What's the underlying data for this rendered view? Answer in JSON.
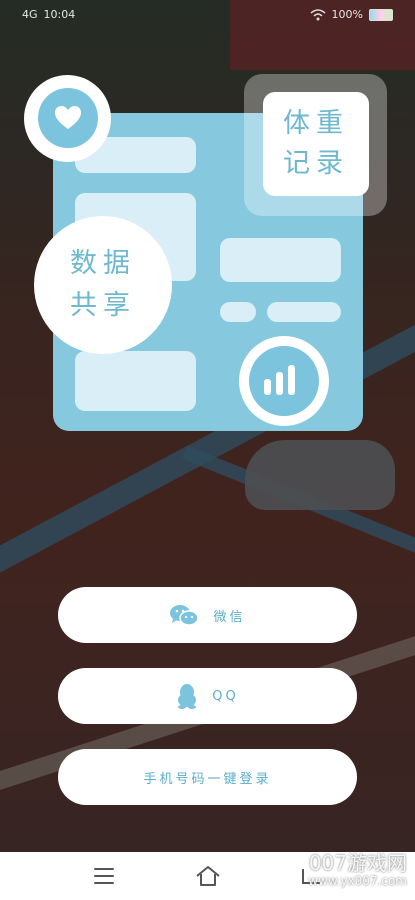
{
  "status_bar": {
    "signal": "4G",
    "time": "10:04",
    "battery": "100%"
  },
  "hero": {
    "weight_title_line1": "体重",
    "weight_title_line2": "记录",
    "share_title_line1": "数据",
    "share_title_line2": "共享",
    "accent_color": "#86c9de"
  },
  "login": {
    "wechat_label": "微信",
    "qq_label": "QQ",
    "phone_label": "手机号码一键登录"
  },
  "watermark": {
    "line1": "007游戏网",
    "line2": "www.yx007.com"
  },
  "icons": [
    "heart-icon",
    "bar-chart-icon",
    "wechat-icon",
    "qq-penguin-icon",
    "menu-icon",
    "home-icon",
    "back-icon"
  ]
}
